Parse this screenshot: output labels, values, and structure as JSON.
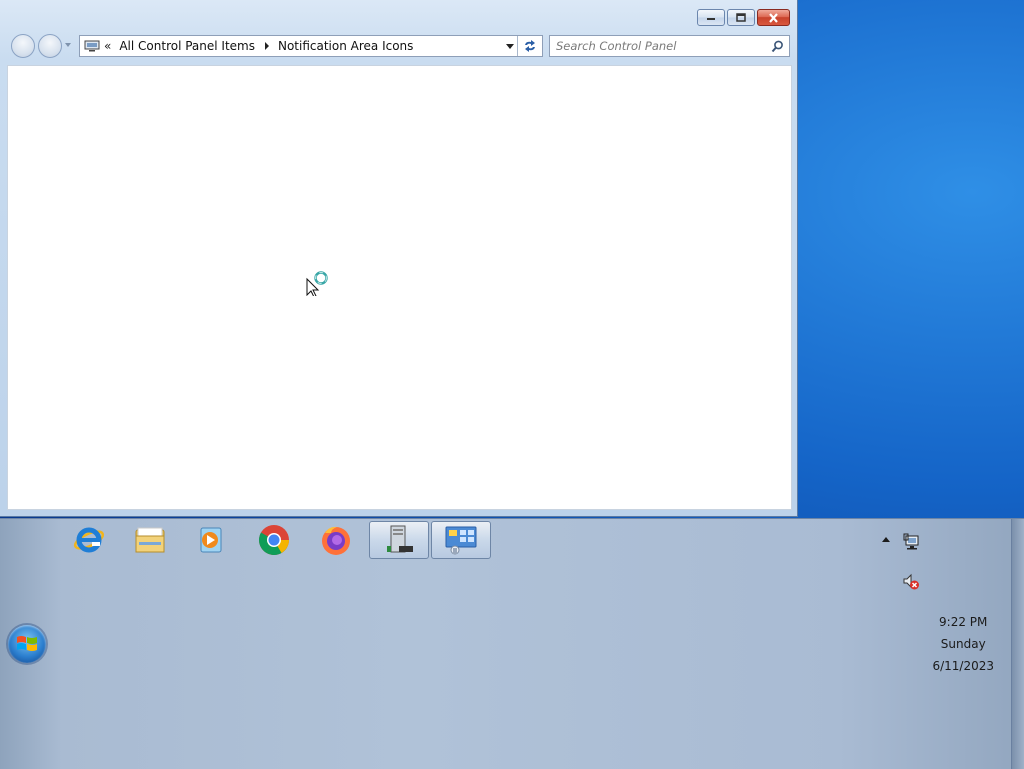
{
  "window": {
    "breadcrumb": {
      "overflow_chevron": "«",
      "items": [
        "All Control Panel Items",
        "Notification Area Icons"
      ]
    },
    "search": {
      "placeholder": "Search Control Panel"
    },
    "caption_icons": [
      "minimize-icon",
      "maximize-icon",
      "close-icon"
    ]
  },
  "taskbar": {
    "pinned": [
      {
        "name": "internet-explorer-icon"
      },
      {
        "name": "windows-explorer-icon"
      },
      {
        "name": "windows-media-player-icon"
      },
      {
        "name": "google-chrome-icon"
      },
      {
        "name": "firefox-icon"
      },
      {
        "name": "server-manager-icon",
        "active": true
      },
      {
        "name": "control-panel-icon",
        "active": true
      }
    ],
    "tray_icons": [
      "show-hidden-icons-arrow",
      "network-icon",
      "volume-muted-icon"
    ],
    "clock": {
      "time": "9:22 PM",
      "day": "Sunday",
      "date": "6/11/2023"
    }
  },
  "colors": {
    "desktop": "#1565c8",
    "taskbar": "#b0c2d8",
    "close_button": "#c8422c"
  }
}
